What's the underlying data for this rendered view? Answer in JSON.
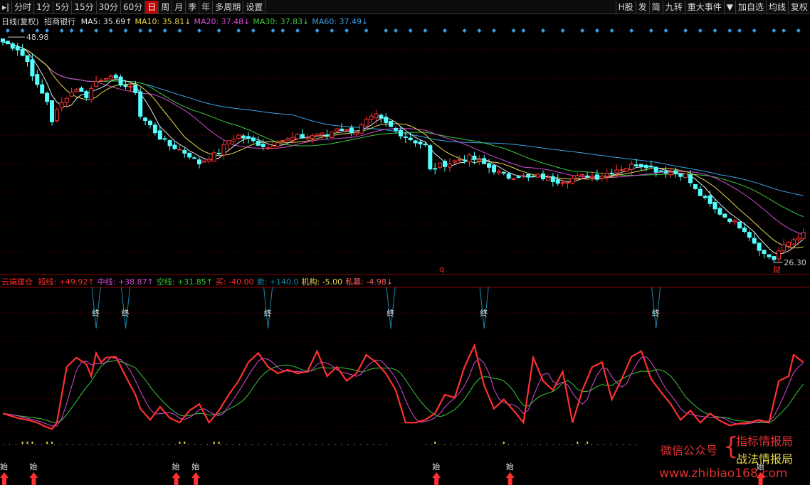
{
  "toolbar": {
    "left": [
      "分时",
      "1分",
      "5分",
      "15分",
      "30分",
      "60分",
      "日",
      "周",
      "月",
      "季",
      "年",
      "多周期",
      "设置"
    ],
    "active": "日",
    "right": [
      "H股",
      "发",
      "简",
      "九转",
      "重大事件",
      "▼",
      "加自选",
      "均线",
      "复权"
    ]
  },
  "main_legend": {
    "period": "日线(复权)",
    "stock": "招商银行",
    "items": [
      {
        "label": "MA5: 35.69↑",
        "color": "#e6e6e6"
      },
      {
        "label": "MA10: 35.81↓",
        "color": "#e8d84c"
      },
      {
        "label": "MA20: 37.48↓",
        "color": "#d24cd2"
      },
      {
        "label": "MA30: 37.83↓",
        "color": "#3cc83c"
      },
      {
        "label": "MA60: 37.49↓",
        "color": "#3ca0e6"
      }
    ]
  },
  "indicator_legend": {
    "name": "云端建仓",
    "items": [
      {
        "label": "短线: +49.92↑",
        "color": "#ff3030"
      },
      {
        "label": "中线: +38.87↑",
        "color": "#d84cd8"
      },
      {
        "label": "空线: +31.85↑",
        "color": "#3cc83c"
      },
      {
        "label": "买: -40.00",
        "color": "#ff3030"
      },
      {
        "label": "卖: +140.0",
        "color": "#1a8ab0"
      },
      {
        "label": "机构: -5.00",
        "color": "#e8d84c"
      },
      {
        "label": "私募: -4.98↓",
        "color": "#ff6060"
      }
    ]
  },
  "markers": {
    "high_label": "48.98",
    "low_label": "26.30",
    "q_label": "q",
    "cai_label": "财",
    "end_label": "终",
    "start_label": "始"
  },
  "watermark": {
    "line1": "微信公众号",
    "line2a": "指标情报局",
    "line2b": "战法情报局",
    "url": "www.zhibiao168.com"
  },
  "colors": {
    "up": "#ff3232",
    "down": "#54ffff",
    "ma5": "#e6e6e6",
    "ma10": "#e8d84c",
    "ma20": "#d24cd2",
    "ma30": "#3cc83c",
    "ma60": "#3ca0e6",
    "grid": "#7a0000",
    "diamond": "#3ca0e6"
  },
  "chart_data": [
    {
      "type": "candlestick",
      "title": "招商银行 日线(复权)",
      "ylim": [
        25,
        50
      ],
      "close_path": [
        [
          0,
          48.5
        ],
        [
          3,
          47.8
        ],
        [
          5,
          46.5
        ],
        [
          7,
          44.0
        ],
        [
          9,
          42.5
        ],
        [
          10,
          40.5
        ],
        [
          11,
          41.5
        ],
        [
          13,
          43.0
        ],
        [
          15,
          43.8
        ],
        [
          17,
          43.0
        ],
        [
          19,
          44.5
        ],
        [
          21,
          45.0
        ],
        [
          23,
          44.6
        ],
        [
          25,
          44.0
        ],
        [
          27,
          43.5
        ],
        [
          28,
          41.0
        ],
        [
          30,
          40.0
        ],
        [
          32,
          38.8
        ],
        [
          34,
          38.0
        ],
        [
          36,
          37.6
        ],
        [
          38,
          37.0
        ],
        [
          40,
          36.2
        ],
        [
          42,
          36.8
        ],
        [
          44,
          37.3
        ],
        [
          46,
          38.5
        ],
        [
          48,
          39.0
        ],
        [
          50,
          38.6
        ],
        [
          52,
          38.2
        ],
        [
          54,
          37.8
        ],
        [
          56,
          38.5
        ],
        [
          58,
          38.6
        ],
        [
          60,
          38.9
        ],
        [
          62,
          38.8
        ],
        [
          64,
          39.2
        ],
        [
          66,
          39.0
        ],
        [
          68,
          39.8
        ],
        [
          70,
          39.5
        ],
        [
          72,
          39.4
        ],
        [
          74,
          40.5
        ],
        [
          76,
          41.0
        ],
        [
          78,
          40.2
        ],
        [
          80,
          39.5
        ],
        [
          82,
          38.9
        ],
        [
          84,
          38.4
        ],
        [
          86,
          38.0
        ],
        [
          87,
          35.5
        ],
        [
          89,
          36.0
        ],
        [
          91,
          36.2
        ],
        [
          93,
          36.6
        ],
        [
          95,
          36.8
        ],
        [
          97,
          36.4
        ],
        [
          99,
          35.8
        ],
        [
          101,
          35.2
        ],
        [
          103,
          34.8
        ],
        [
          105,
          35.0
        ],
        [
          107,
          34.7
        ],
        [
          109,
          34.9
        ],
        [
          111,
          34.6
        ],
        [
          113,
          34.4
        ],
        [
          115,
          34.5
        ],
        [
          117,
          34.8
        ],
        [
          119,
          35.0
        ],
        [
          121,
          34.8
        ],
        [
          123,
          35.2
        ],
        [
          125,
          35.6
        ],
        [
          127,
          35.8
        ],
        [
          129,
          36.1
        ],
        [
          131,
          36.0
        ],
        [
          133,
          35.5
        ],
        [
          135,
          35.4
        ],
        [
          137,
          35.2
        ],
        [
          139,
          35.0
        ],
        [
          141,
          33.5
        ],
        [
          143,
          32.5
        ],
        [
          145,
          31.5
        ],
        [
          147,
          30.8
        ],
        [
          149,
          30.2
        ],
        [
          151,
          29.5
        ],
        [
          153,
          28.2
        ],
        [
          155,
          27.0
        ],
        [
          157,
          26.5
        ],
        [
          158,
          27.3
        ],
        [
          160,
          28.2
        ],
        [
          162,
          28.8
        ],
        [
          163,
          29.0
        ]
      ],
      "ma_last": {
        "MA5": 35.69,
        "MA10": 35.81,
        "MA20": 37.48,
        "MA30": 37.83,
        "MA60": 37.49
      },
      "high": 48.98,
      "low": 26.3
    },
    {
      "type": "line",
      "title": "云端建仓",
      "ylim": [
        -40,
        140
      ],
      "series": [
        {
          "name": "短线",
          "path": [
            [
              0,
              5
            ],
            [
              3,
              0
            ],
            [
              5,
              -2
            ],
            [
              7,
              -5
            ],
            [
              9,
              -10
            ],
            [
              10,
              -12
            ],
            [
              11,
              -5
            ],
            [
              13,
              55
            ],
            [
              15,
              65
            ],
            [
              17,
              58
            ],
            [
              18,
              45
            ],
            [
              19,
              70
            ],
            [
              20,
              60
            ],
            [
              21,
              65
            ],
            [
              23,
              66
            ],
            [
              25,
              45
            ],
            [
              27,
              25
            ],
            [
              28,
              10
            ],
            [
              30,
              -2
            ],
            [
              32,
              12
            ],
            [
              34,
              0
            ],
            [
              36,
              -5
            ],
            [
              38,
              8
            ],
            [
              40,
              15
            ],
            [
              42,
              -5
            ],
            [
              44,
              8
            ],
            [
              46,
              25
            ],
            [
              48,
              40
            ],
            [
              50,
              60
            ],
            [
              52,
              70
            ],
            [
              54,
              55
            ],
            [
              56,
              48
            ],
            [
              58,
              52
            ],
            [
              60,
              48
            ],
            [
              62,
              50
            ],
            [
              64,
              72
            ],
            [
              66,
              45
            ],
            [
              68,
              55
            ],
            [
              70,
              40
            ],
            [
              72,
              48
            ],
            [
              74,
              68
            ],
            [
              76,
              60
            ],
            [
              78,
              48
            ],
            [
              80,
              30
            ],
            [
              82,
              -5
            ],
            [
              84,
              -5
            ],
            [
              86,
              -2
            ],
            [
              88,
              5
            ],
            [
              90,
              25
            ],
            [
              92,
              22
            ],
            [
              94,
              55
            ],
            [
              96,
              78
            ],
            [
              98,
              35
            ],
            [
              100,
              10
            ],
            [
              102,
              20
            ],
            [
              104,
              8
            ],
            [
              106,
              -5
            ],
            [
              108,
              65
            ],
            [
              110,
              40
            ],
            [
              112,
              30
            ],
            [
              114,
              50
            ],
            [
              116,
              -5
            ],
            [
              118,
              30
            ],
            [
              120,
              55
            ],
            [
              122,
              60
            ],
            [
              124,
              20
            ],
            [
              126,
              42
            ],
            [
              128,
              66
            ],
            [
              130,
              72
            ],
            [
              132,
              42
            ],
            [
              134,
              28
            ],
            [
              136,
              15
            ],
            [
              138,
              -2
            ],
            [
              140,
              8
            ],
            [
              142,
              -5
            ],
            [
              144,
              5
            ],
            [
              146,
              -3
            ],
            [
              148,
              -8
            ],
            [
              150,
              -6
            ],
            [
              152,
              -5
            ],
            [
              154,
              -2
            ],
            [
              156,
              -5
            ],
            [
              158,
              40
            ],
            [
              160,
              45
            ],
            [
              161,
              68
            ],
            [
              163,
              60
            ]
          ]
        }
      ]
    }
  ]
}
